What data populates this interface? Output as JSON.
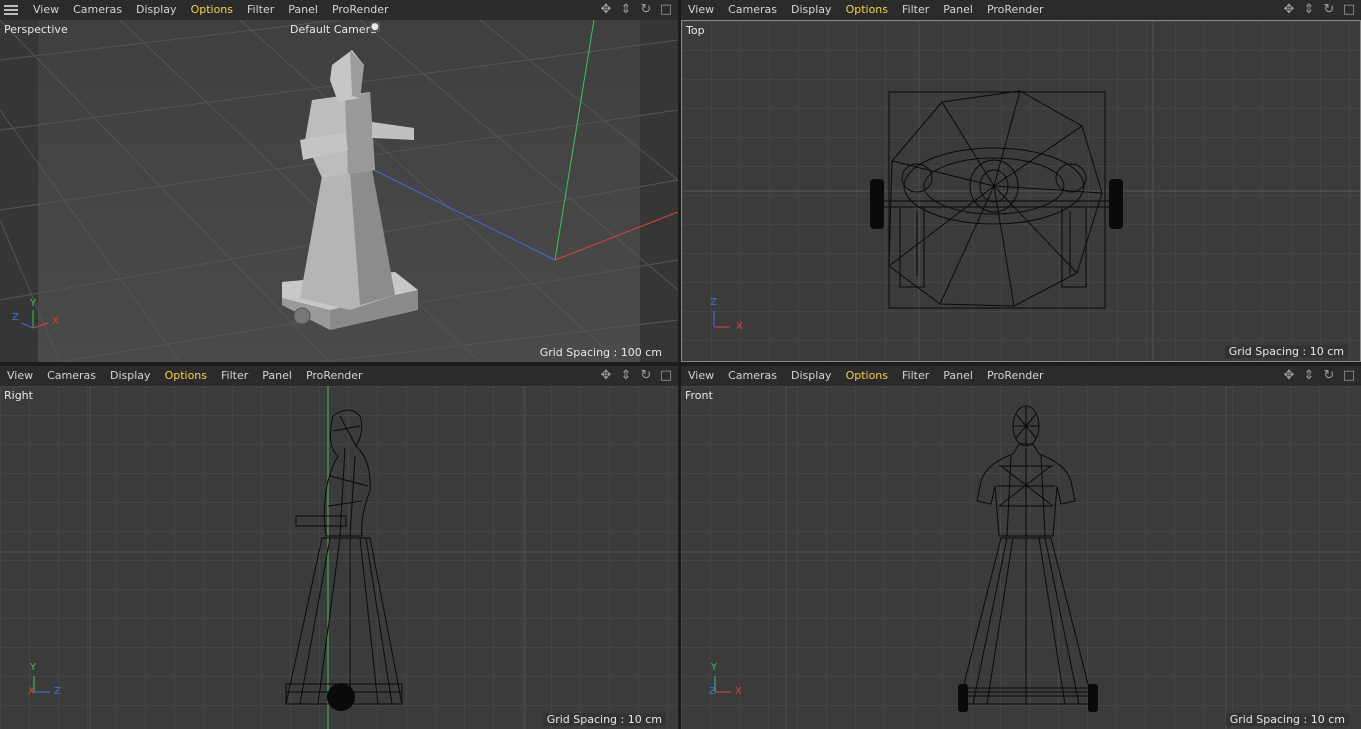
{
  "menu": {
    "items": [
      "View",
      "Cameras",
      "Display",
      "Options",
      "Filter",
      "Panel",
      "ProRender"
    ],
    "active": "Options"
  },
  "viewports": {
    "perspective": {
      "name": "Perspective",
      "camera": "Default Camera",
      "grid": "Grid Spacing : 100 cm"
    },
    "top": {
      "name": "Top",
      "grid": "Grid Spacing : 10 cm"
    },
    "right": {
      "name": "Right",
      "grid": "Grid Spacing : 10 cm"
    },
    "front": {
      "name": "Front",
      "grid": "Grid Spacing : 10 cm"
    }
  },
  "axes": {
    "x": "X",
    "y": "Y",
    "z": "Z"
  },
  "icons": [
    "menu-icon",
    "move-view-icon",
    "zoom-view-icon",
    "rotate-view-icon",
    "maximize-view-icon"
  ],
  "colors": {
    "active_menu": "#f2d24a",
    "axis_x": "#e04040",
    "axis_y": "#40c060",
    "axis_z": "#4070e0"
  }
}
